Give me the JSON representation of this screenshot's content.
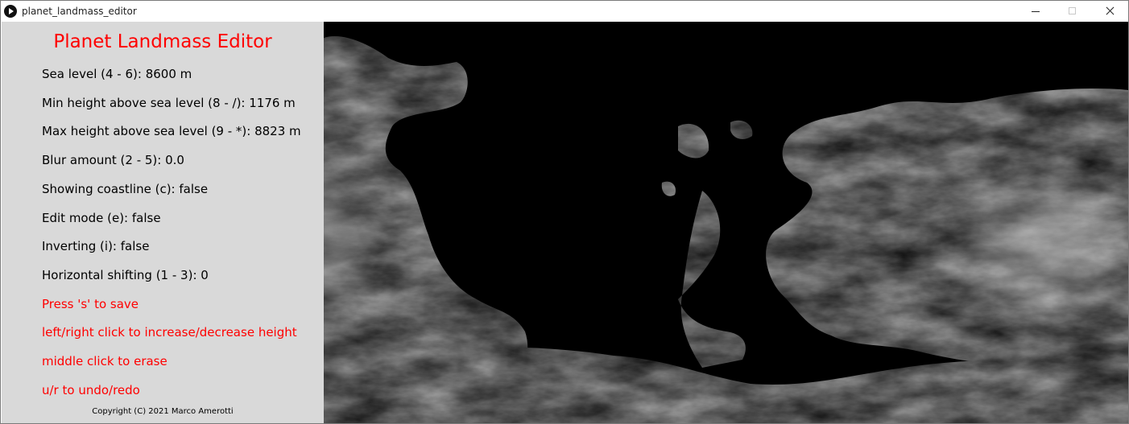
{
  "window": {
    "title": "planet_landmass_editor",
    "app_icon": "play-circle-icon"
  },
  "panel": {
    "title": "Planet Landmass Editor",
    "title_color": "#ff0000",
    "background": "#d9d9d9",
    "settings": [
      "Sea level (4 - 6): 8600 m",
      "Min height above sea level (8 - /): 1176 m",
      "Max height above sea level (9 - *): 8823 m",
      "Blur amount (2 - 5): 0.0",
      "Showing coastline (c): false",
      "Edit mode (e): false",
      "Inverting (i): false",
      "Horizontal shifting (1 - 3): 0"
    ],
    "instructions": [
      "Press 's' to save",
      "left/right click to increase/decrease height",
      "middle click to erase",
      "u/r to undo/redo"
    ],
    "copyright": "Copyright (C) 2021  Marco Amerotti"
  },
  "map": {
    "ocean_color": "#000000",
    "land_color": "#8c8c8c"
  }
}
